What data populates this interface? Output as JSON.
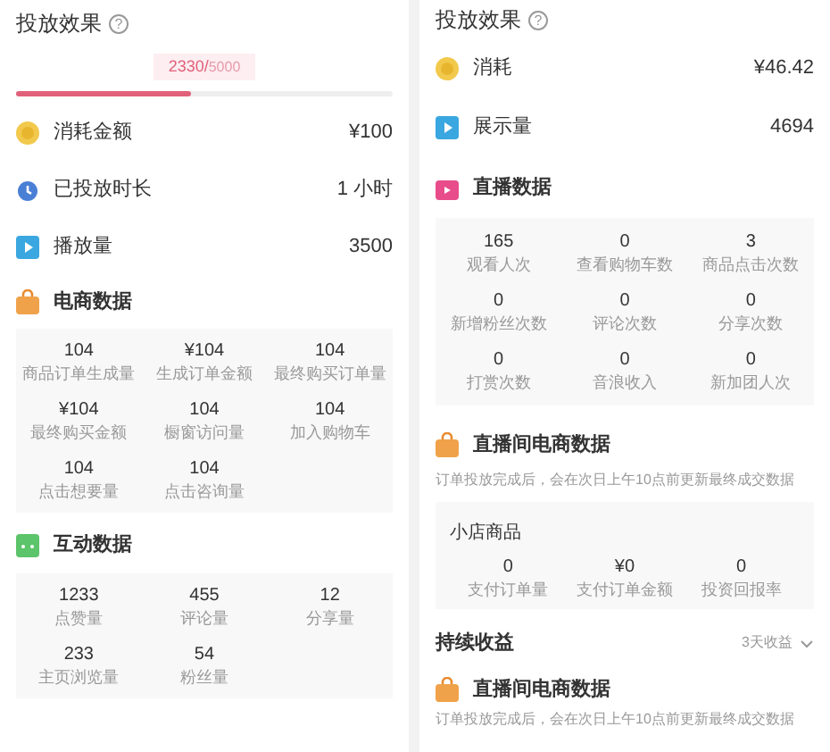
{
  "left": {
    "title": "投放效果",
    "help": "?",
    "progress": {
      "value": "2330/",
      "total": "5000",
      "level": 0.466
    },
    "metrics": [
      {
        "kind": "coin",
        "label": "消耗金额",
        "value": "¥100"
      },
      {
        "kind": "clock",
        "label": "已投放时长",
        "value": "1 小时"
      },
      {
        "kind": "play",
        "label": "播放量",
        "value": "3500"
      }
    ],
    "sections": [
      {
        "kind": "bag",
        "title": "电商数据",
        "stats": [
          {
            "value": "104",
            "label": "商品订单生成量"
          },
          {
            "value": "¥104",
            "label": "生成订单金额"
          },
          {
            "value": "104",
            "label": "最终购买订单量"
          },
          {
            "value": "¥104",
            "label": "最终购买金额"
          },
          {
            "value": "104",
            "label": "橱窗访问量"
          },
          {
            "value": "104",
            "label": "加入购物车"
          },
          {
            "value": "104",
            "label": "点击想要量"
          },
          {
            "value": "104",
            "label": "点击咨询量"
          }
        ]
      },
      {
        "kind": "chat",
        "title": "互动数据",
        "stats": [
          {
            "value": "1233",
            "label": "点赞量"
          },
          {
            "value": "455",
            "label": "评论量"
          },
          {
            "value": "12",
            "label": "分享量"
          },
          {
            "value": "233",
            "label": "主页浏览量"
          },
          {
            "value": "54",
            "label": "粉丝量"
          }
        ]
      }
    ]
  },
  "right": {
    "title": "投放效果",
    "help": "?",
    "metrics": [
      {
        "kind": "coin",
        "label": "消耗",
        "value": "¥46.42"
      },
      {
        "kind": "play",
        "label": "展示量",
        "value": "4694"
      }
    ],
    "live": {
      "kind": "live",
      "title": "直播数据",
      "stats": [
        {
          "value": "165",
          "label": "观看人次"
        },
        {
          "value": "0",
          "label": "查看购物车数"
        },
        {
          "value": "3",
          "label": "商品点击次数"
        },
        {
          "value": "0",
          "label": "新增粉丝次数"
        },
        {
          "value": "0",
          "label": "评论次数"
        },
        {
          "value": "0",
          "label": "分享次数"
        },
        {
          "value": "0",
          "label": "打赏次数"
        },
        {
          "value": "0",
          "label": "音浪收入"
        },
        {
          "value": "0",
          "label": "新加团人次"
        }
      ]
    },
    "ecommerce": {
      "kind": "bag",
      "title": "直播间电商数据",
      "note": "订单投放完成后，会在次日上午10点前更新最终成交数据",
      "card": {
        "title": "小店商品",
        "stats": [
          {
            "value": "0",
            "label": "支付订单量"
          },
          {
            "value": "¥0",
            "label": "支付订单金额"
          },
          {
            "value": "0",
            "label": "投资回报率"
          }
        ]
      }
    },
    "ongoing": {
      "title": "持续收益",
      "dropdown": "3天收益"
    },
    "ecommerce2": {
      "kind": "bag",
      "title": "直播间电商数据",
      "note": "订单投放完成后，会在次日上午10点前更新最终成交数据"
    }
  }
}
